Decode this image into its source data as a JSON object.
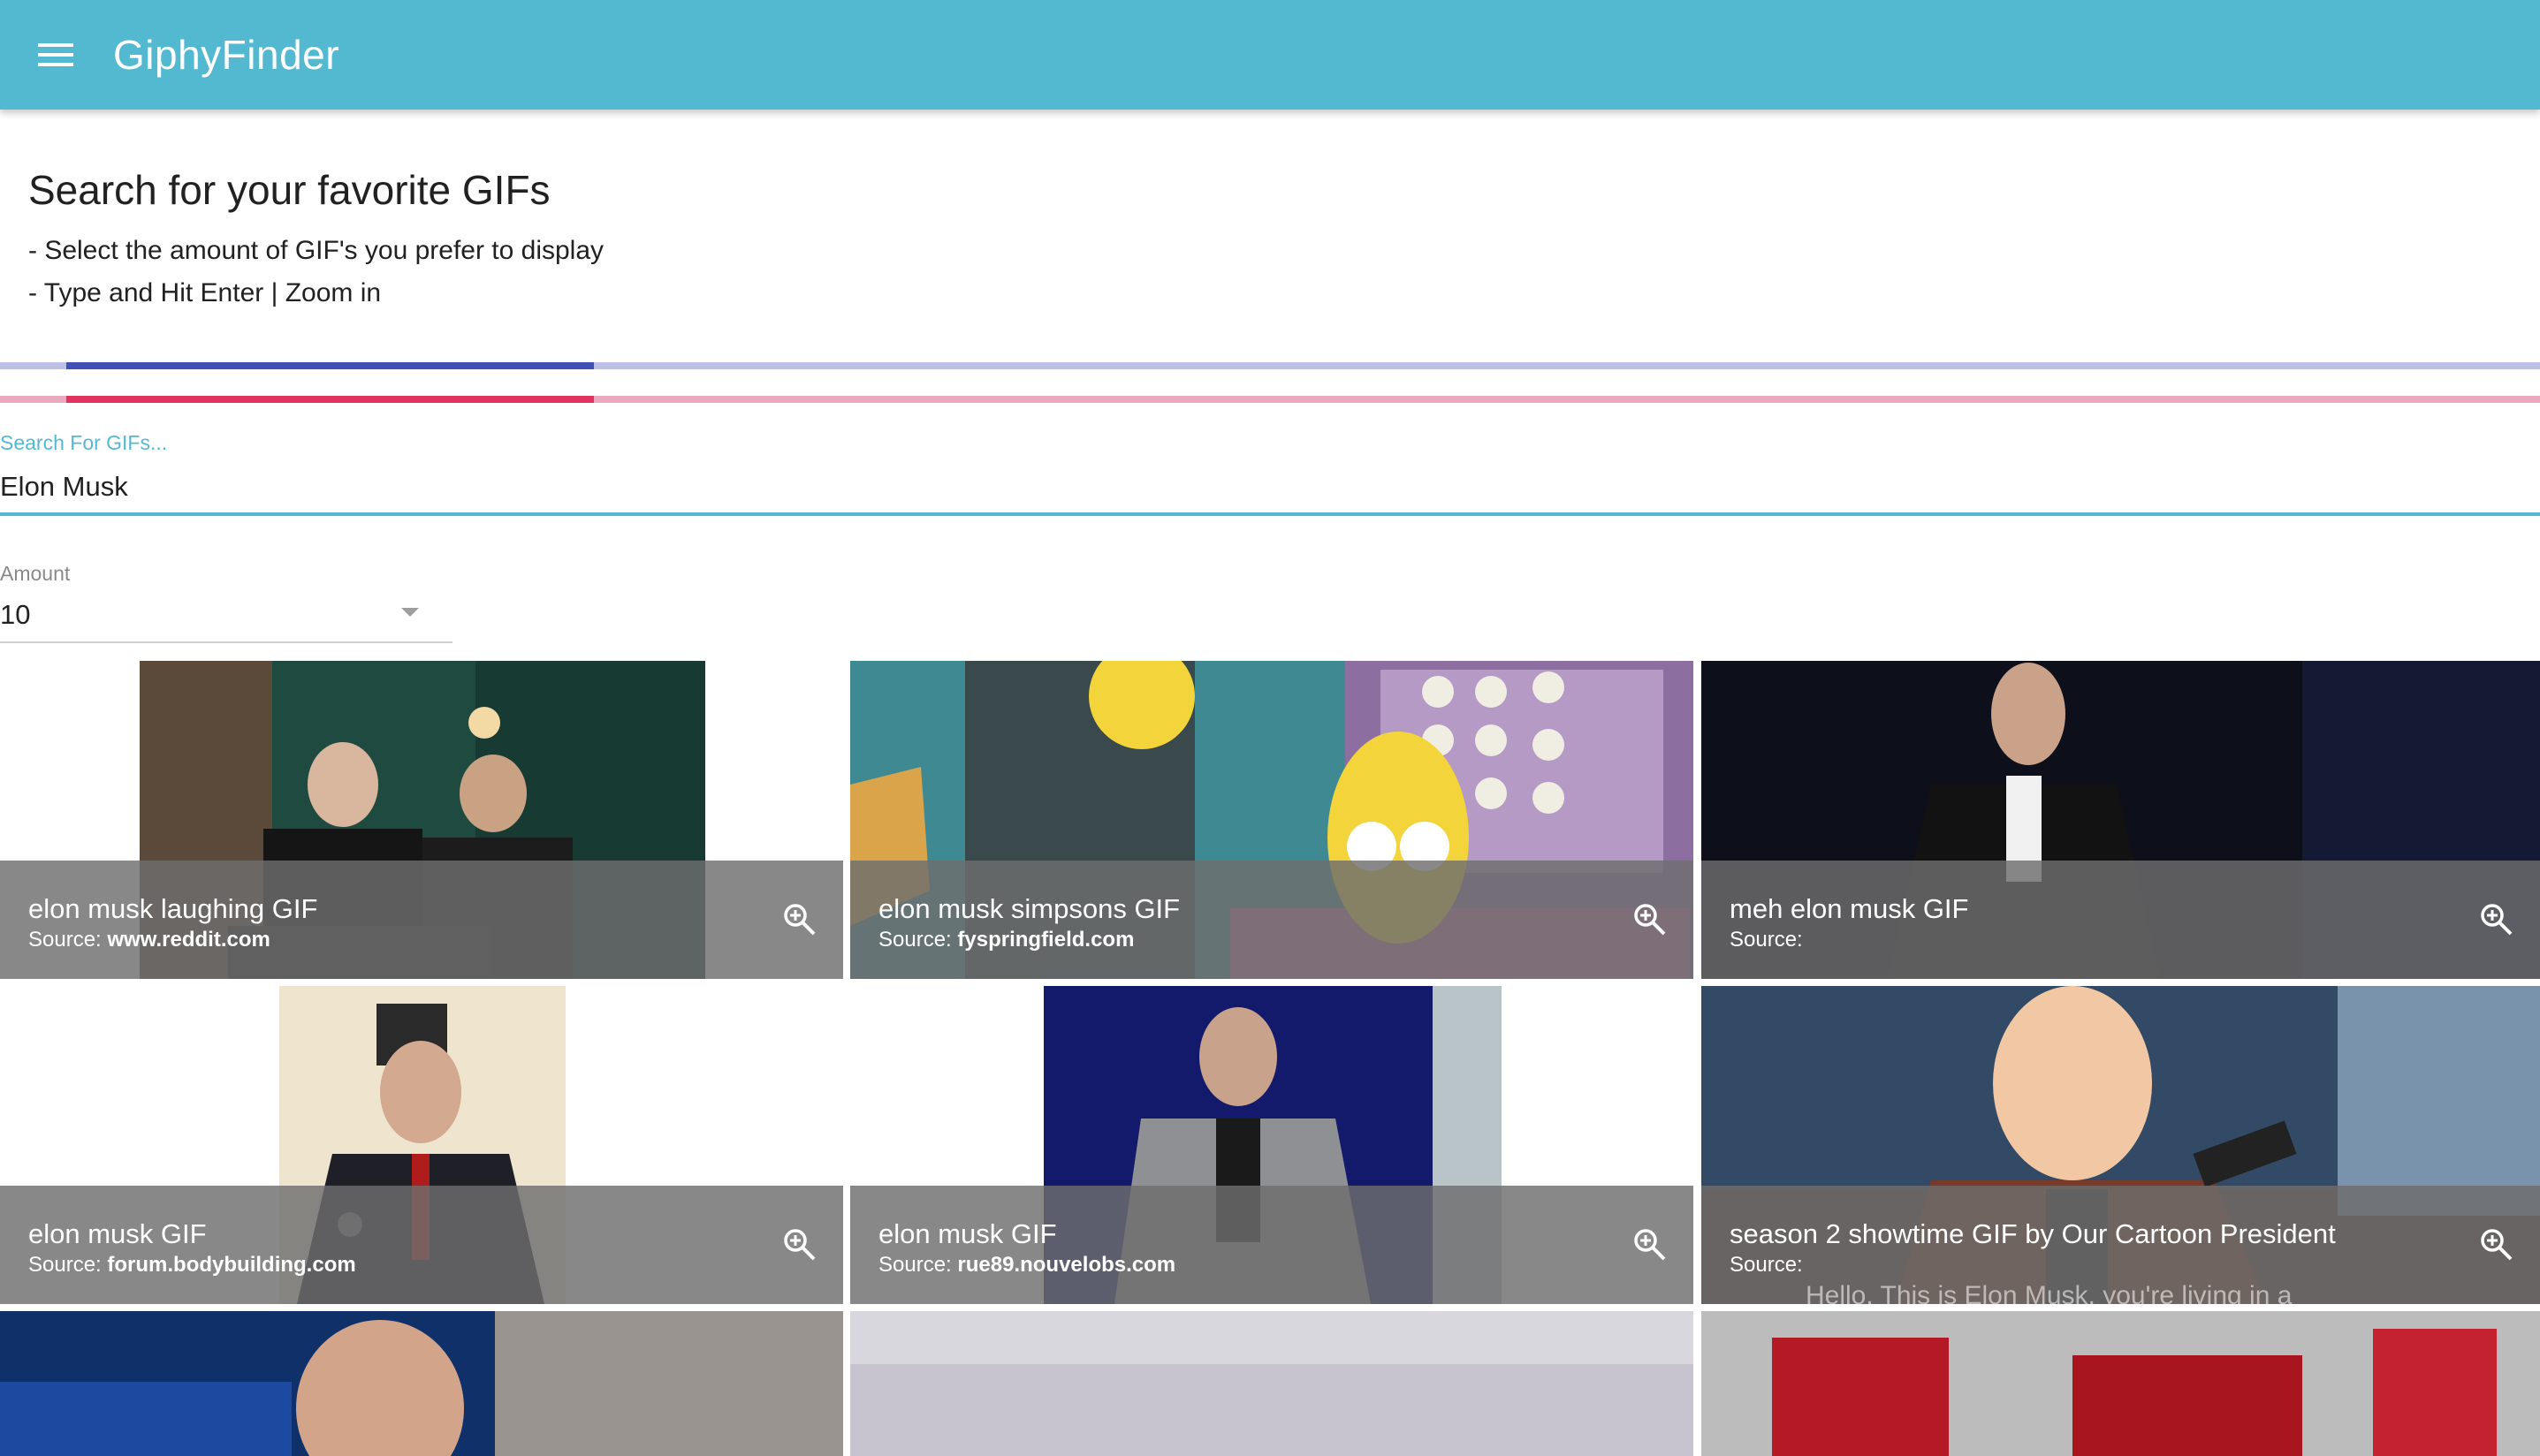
{
  "app": {
    "title": "GiphyFinder"
  },
  "intro": {
    "heading": "Search for your favorite GIFs",
    "line1": "- Select the amount of GIF's you prefer to display",
    "line2": "- Type and Hit Enter | Zoom in"
  },
  "search": {
    "label": "Search For GIFs...",
    "value": "Elon Musk"
  },
  "amount": {
    "label": "Amount",
    "value": "10"
  },
  "source_label": "Source:",
  "gifs": [
    {
      "title": "elon musk laughing GIF",
      "source": "www.reddit.com"
    },
    {
      "title": "elon musk simpsons GIF",
      "source": "fyspringfield.com"
    },
    {
      "title": "meh elon musk GIF",
      "source": ""
    },
    {
      "title": "elon musk GIF",
      "source": "forum.bodybuilding.com"
    },
    {
      "title": "elon musk GIF",
      "source": "rue89.nouvelobs.com"
    },
    {
      "title": "season 2 showtime GIF by Our Cartoon President",
      "source": "",
      "caption": "Hello. This is Elon Musk, you're living in a"
    }
  ],
  "colors": {
    "appbar": "#53b9d1",
    "progress_primary": "#3f51b5",
    "progress_accent": "#e0335f"
  },
  "icons": {
    "menu": "menu-icon",
    "zoom": "zoom-in-icon"
  }
}
